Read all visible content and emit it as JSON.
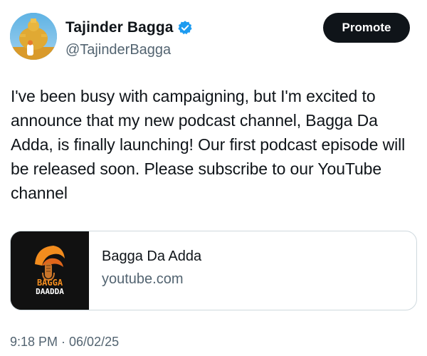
{
  "author": {
    "name": "Tajinder Bagga",
    "handle": "@TajinderBagga",
    "verified_color": "#1d9bf0"
  },
  "actions": {
    "promote_label": "Promote"
  },
  "tweet": {
    "text": "I've been busy with campaigning, but I'm excited to announce that my new podcast channel, Bagga Da Adda, is finally launching! Our first podcast episode will be released soon. Please subscribe to our YouTube channel",
    "timestamp": "9:18 PM · 06/02/25"
  },
  "link_card": {
    "title": "Bagga Da Adda",
    "domain": "youtube.com",
    "logo_line1": "BAGGA",
    "logo_line2": "DAADDA",
    "logo_accent": "#f28c1e"
  },
  "colors": {
    "text_primary": "#0f1419",
    "text_secondary": "#536471",
    "button_bg": "#0f1419",
    "card_border": "#cfd9de"
  }
}
